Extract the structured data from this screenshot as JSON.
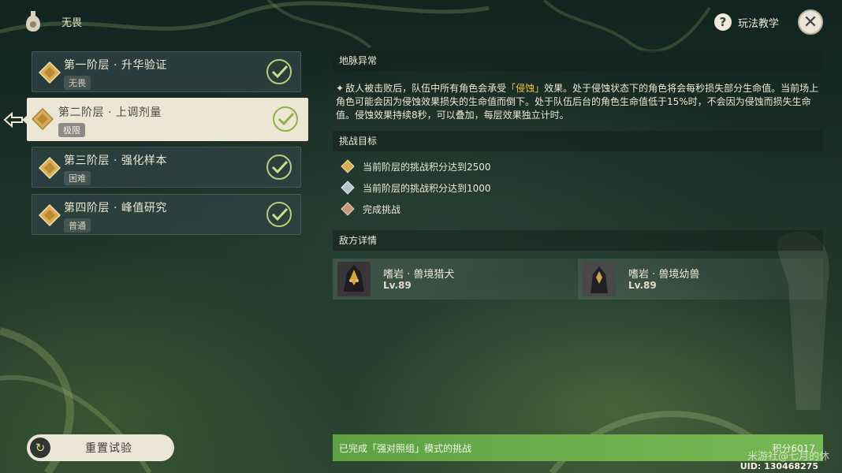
{
  "header": {
    "title": "无畏",
    "help_label": "玩法教学",
    "close_symbol": "✕",
    "help_symbol": "?"
  },
  "stages": [
    {
      "name": "第一阶层 · 升华验证",
      "difficulty": "无畏",
      "completed": true,
      "selected": false
    },
    {
      "name": "第二阶层 · 上调剂量",
      "difficulty": "极限",
      "completed": true,
      "selected": true
    },
    {
      "name": "第三阶层 · 强化样本",
      "difficulty": "困难",
      "completed": true,
      "selected": false
    },
    {
      "name": "第四阶层 · 峰值研究",
      "difficulty": "普通",
      "completed": true,
      "selected": false
    }
  ],
  "ley_line": {
    "heading": "地脉异常",
    "bullet": "✦",
    "text_before": "敌人被击败后，队伍中所有角色会承受",
    "highlight": "「侵蚀」",
    "text_after": "效果。处于侵蚀状态下的角色将会每秒损失部分生命值。当前场上角色可能会因为侵蚀效果损失的生命值而倒下。处于队伍后台的角色生命值低于15%时，不会因为侵蚀而损失生命值。侵蚀效果持续8秒，可以叠加，每层效果独立计时。"
  },
  "challenge": {
    "heading": "挑战目标",
    "goals": [
      {
        "text": "当前阶层的挑战积分达到2500",
        "tier": "gold"
      },
      {
        "text": "当前阶层的挑战积分达到1000",
        "tier": "silver"
      },
      {
        "text": "完成挑战",
        "tier": "bronze"
      }
    ]
  },
  "enemies": {
    "heading": "敌方详情",
    "list": [
      {
        "name": "嗜岩 · 兽境猎犬",
        "level": "Lv.89"
      },
      {
        "name": "嗜岩 · 兽境幼兽",
        "level": "Lv.89"
      }
    ]
  },
  "footer": {
    "reset_label": "重置试验",
    "reset_icon": "↻",
    "complete_text": "已完成「强对照组」模式的挑战",
    "score": "积分6017",
    "watermark": "米游社@七月的休",
    "uid": "UID: 130468275"
  },
  "colors": {
    "highlight": "#f3c040",
    "complete_bar": "#6fb14c",
    "check": "#8fb04a",
    "gold_gem": "#d9ad55",
    "silver_gem": "#b7c2cc",
    "bronze_gem": "#c79a7e"
  },
  "icons": [
    "bottle-icon",
    "help-icon",
    "close-icon",
    "stage-diamond-icon",
    "check-icon",
    "pointer-arrow-icon",
    "reset-icon",
    "goal-gem-icon"
  ]
}
